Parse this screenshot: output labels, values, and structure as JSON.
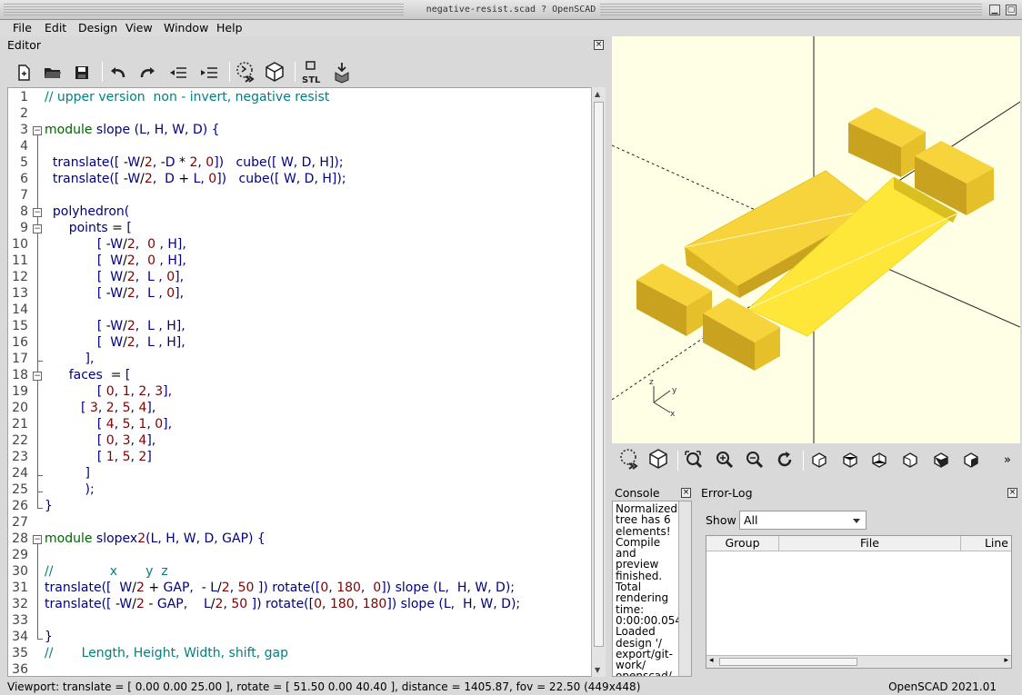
{
  "window": {
    "title": "negative-resist.scad ? OpenSCAD"
  },
  "menu": [
    {
      "label": "File"
    },
    {
      "label": "Edit"
    },
    {
      "label": "Design"
    },
    {
      "label": "View"
    },
    {
      "label": "Window"
    },
    {
      "label": "Help"
    }
  ],
  "editor": {
    "title": "Editor",
    "toolbar_icons": [
      "new-file-icon",
      "open-file-icon",
      "save-icon",
      "undo-icon",
      "redo-icon",
      "unindent-icon",
      "indent-icon",
      "preview-icon",
      "render-icon",
      "export-stl-icon",
      "send-to-print-icon"
    ],
    "stl_label": "STL",
    "lines": [
      "// upper version  non - invert, negative resist",
      "",
      "module slope (L, H, W, D) {",
      "",
      "  translate([ -W/2, -D * 2, 0])   cube([ W, D, H]);",
      "  translate([ -W/2,  D + L, 0])   cube([ W, D, H]);",
      "",
      "  polyhedron(",
      "      points = [",
      "             [ -W/2,  0 , H],",
      "             [  W/2,  0 , H],",
      "             [  W/2,  L , 0],",
      "             [ -W/2,  L , 0],",
      "",
      "             [ -W/2,  L , H],",
      "             [  W/2,  L , H],",
      "          ],",
      "      faces  = [",
      "             [ 0, 1, 2, 3],",
      "         [ 3, 2, 5, 4],",
      "             [ 4, 5, 1, 0],",
      "             [ 0, 3, 4],",
      "             [ 1, 5, 2]",
      "          ]",
      "          );",
      "}",
      "",
      "module slopex2(L, H, W, D, GAP) {",
      "",
      "//              x       y  z",
      "translate([  W/2 + GAP,  - L/2, 50 ]) rotate([0, 180,  0]) slope (L,  H, W, D);",
      "translate([ -W/2 - GAP,    L/2, 50 ]) rotate([0, 180, 180]) slope (L,  H, W, D);",
      "",
      "}",
      "//       Length, Height, Width, shift, gap",
      ""
    ]
  },
  "view_toolbar_icons": [
    "preview-icon",
    "render-icon",
    "zoom-all-icon",
    "zoom-in-icon",
    "zoom-out-icon",
    "reset-view-icon",
    "view-right-icon",
    "view-top-icon",
    "view-bottom-icon",
    "view-left-icon",
    "view-front-icon",
    "view-back-icon",
    "more-icon"
  ],
  "console": {
    "title": "Console",
    "lines": [
      "Normalized",
      "tree has 6",
      "elements!",
      "Compile",
      "and",
      "preview",
      "finished.",
      "Total",
      "rendering",
      "time:",
      "0:00:00.054",
      "Loaded",
      "design '/",
      "export/git-",
      "work/",
      "openscad/"
    ]
  },
  "error_log": {
    "title": "Error-Log",
    "show_label": "Show",
    "show_value": "All",
    "columns": [
      "Group",
      "File",
      "Line"
    ]
  },
  "axes": {
    "z": "z",
    "y": "y",
    "x": "x"
  },
  "status": {
    "viewport": "Viewport: translate = [ 0.00 0.00 25.00 ], rotate = [ 51.50 0.00 40.40 ], distance = 1405.87, fov = 22.50 (449x448)",
    "version": "OpenSCAD 2021.01"
  },
  "colors": {
    "viewport_bg": "#ffffe5",
    "model_yellow": "#f9d52e",
    "comment": "#008080",
    "keyword": "#006400",
    "number": "#800000"
  }
}
